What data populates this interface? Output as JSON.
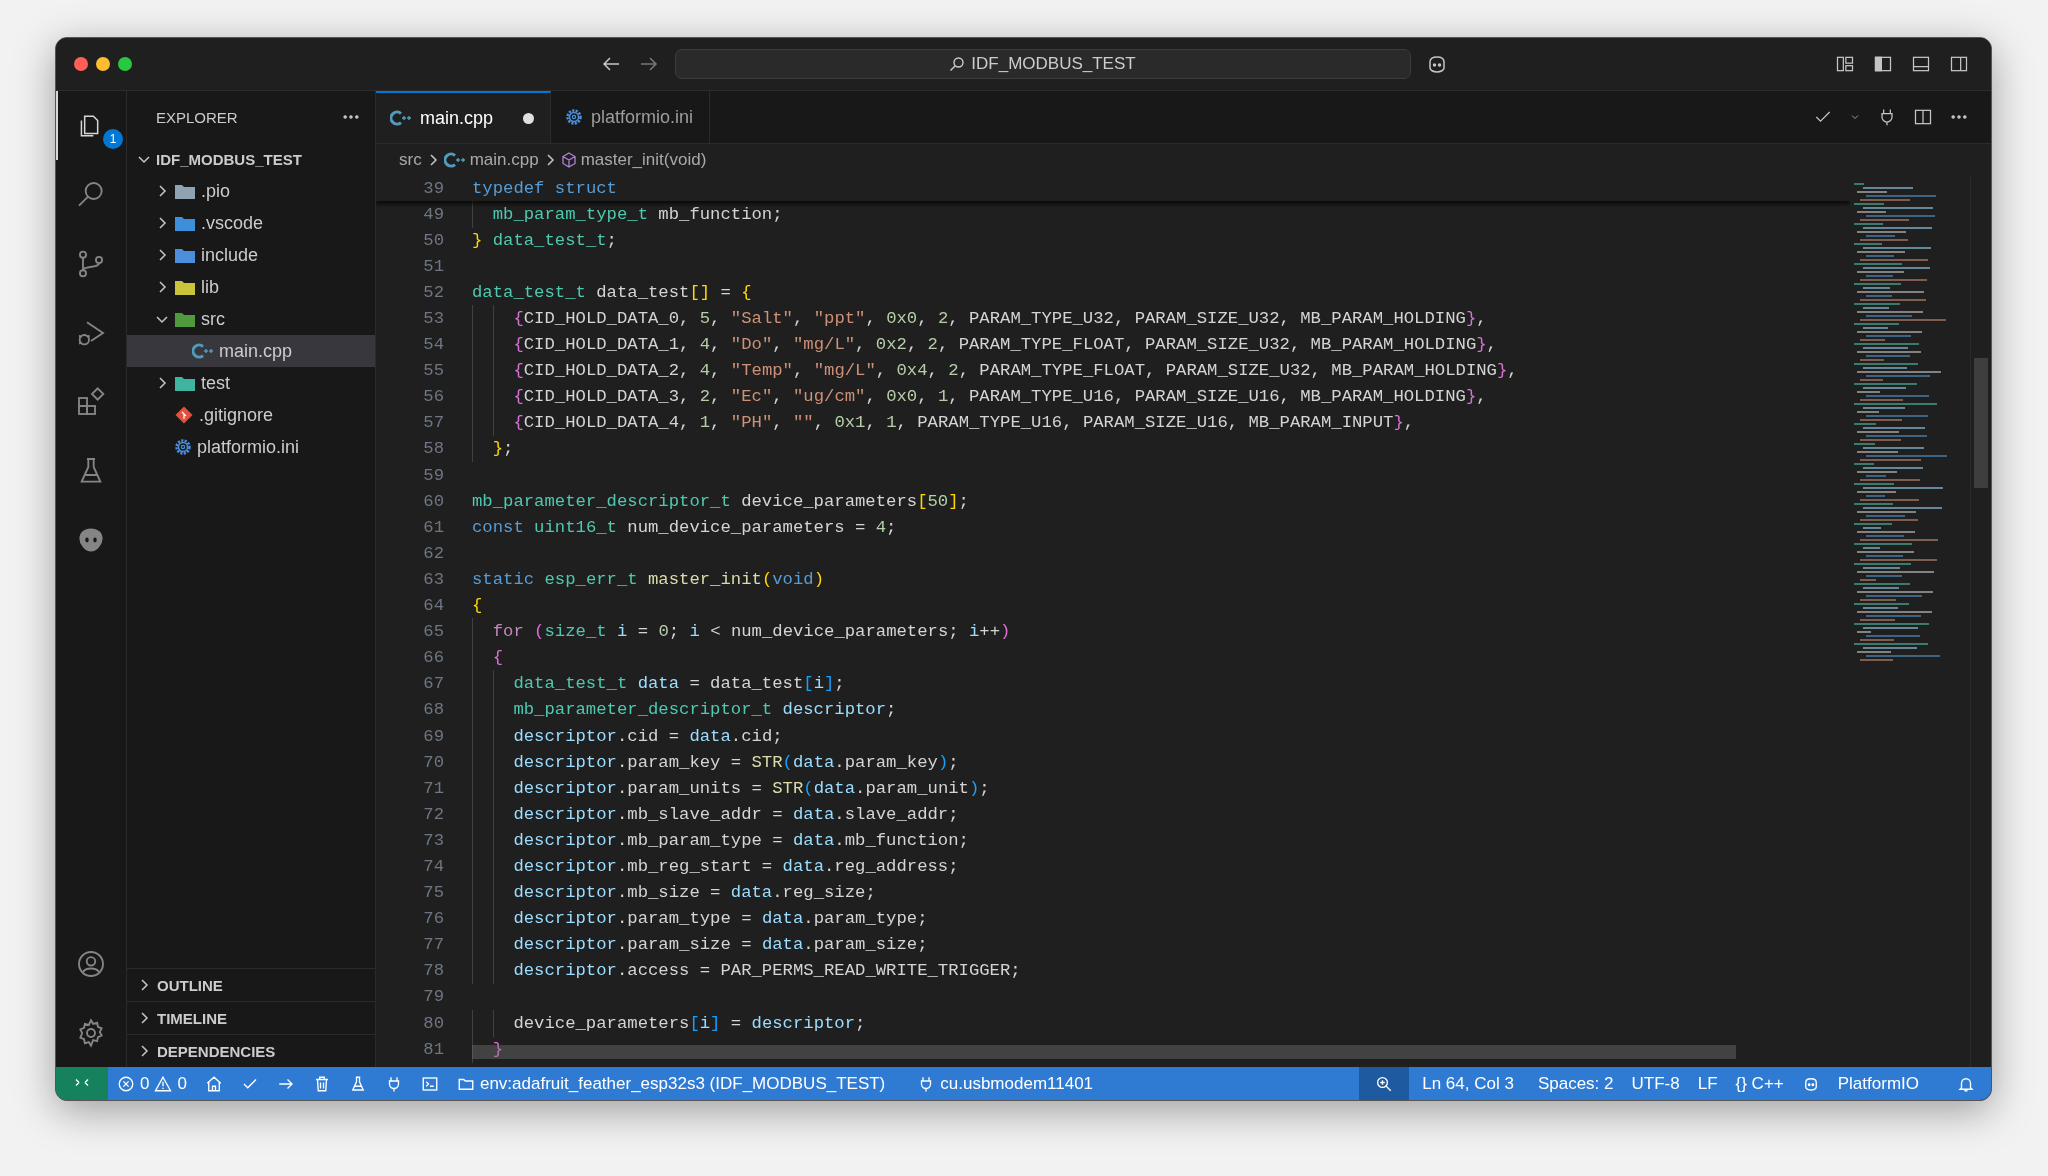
{
  "title_bar": {
    "search": "IDF_MODBUS_TEST"
  },
  "activity_bar": {
    "badge": "1"
  },
  "explorer": {
    "title": "EXPLORER",
    "root": {
      "label": "IDF_MODBUS_TEST",
      "expanded": true,
      "children": [
        {
          "label": ".pio",
          "kind": "folder",
          "expanded": false,
          "selected": false
        },
        {
          "label": ".vscode",
          "kind": "vscode-folder",
          "expanded": false,
          "selected": false
        },
        {
          "label": "include",
          "kind": "include-folder",
          "expanded": false,
          "selected": false
        },
        {
          "label": "lib",
          "kind": "lib-folder",
          "expanded": false,
          "selected": false
        },
        {
          "label": "src",
          "kind": "source-folder",
          "expanded": true,
          "selected": false,
          "children": [
            {
              "label": "main.cpp",
              "kind": "cpp-file",
              "selected": true
            }
          ]
        },
        {
          "label": "test",
          "kind": "test-folder",
          "expanded": false,
          "selected": false
        },
        {
          "label": ".gitignore",
          "kind": "git-file",
          "selected": false
        },
        {
          "label": "platformio.ini",
          "kind": "settings-file",
          "selected": false
        }
      ]
    },
    "sections": [
      {
        "label": "OUTLINE",
        "expanded": false
      },
      {
        "label": "TIMELINE",
        "expanded": false
      },
      {
        "label": "DEPENDENCIES",
        "expanded": false
      }
    ]
  },
  "tabs": [
    {
      "label": "main.cpp",
      "kind": "cpp",
      "selected": true,
      "modified": true
    },
    {
      "label": "platformio.ini",
      "kind": "settings",
      "selected": false,
      "modified": false
    }
  ],
  "breadcrumbs": [
    {
      "label": "src",
      "kind": "folder"
    },
    {
      "label": "main.cpp",
      "kind": "cpp"
    },
    {
      "label": "master_init(void)",
      "kind": "function"
    }
  ],
  "editor": {
    "sticky_line": {
      "number": "39",
      "tokens": [
        {
          "kind": "kw",
          "text": "typedef"
        },
        {
          "kind": "kw",
          "text": " struct"
        }
      ]
    },
    "lines": [
      {
        "number": "49",
        "tokens": [
          {
            "kind": "type",
            "text": "  mb_param_type_t"
          },
          {
            "kind": "plain",
            "text": " mb_function;"
          }
        ]
      },
      {
        "number": "50",
        "tokens": [
          {
            "kind": "b1",
            "text": "}"
          },
          {
            "kind": "type",
            "text": " data_test_t"
          },
          {
            "kind": "plain",
            "text": ";"
          }
        ]
      },
      {
        "number": "51"
      },
      {
        "number": "52",
        "tokens": [
          {
            "kind": "type",
            "text": "data_test_t"
          },
          {
            "kind": "plain",
            "text": " data_test"
          },
          {
            "kind": "b1",
            "text": "[]"
          },
          {
            "kind": "plain",
            "text": " = "
          },
          {
            "kind": "b1",
            "text": "{"
          }
        ]
      },
      {
        "number": "53",
        "tokens": [
          {
            "kind": "b2",
            "text": "    {"
          },
          {
            "kind": "plain",
            "text": "CID_HOLD_DATA_0, "
          },
          {
            "kind": "num",
            "text": "5"
          },
          {
            "kind": "plain",
            "text": ", "
          },
          {
            "kind": "str",
            "text": "\"Salt\""
          },
          {
            "kind": "plain",
            "text": ", "
          },
          {
            "kind": "str",
            "text": "\"ppt\""
          },
          {
            "kind": "plain",
            "text": ", "
          },
          {
            "kind": "num",
            "text": "0x0"
          },
          {
            "kind": "plain",
            "text": ", "
          },
          {
            "kind": "num",
            "text": "2"
          },
          {
            "kind": "plain",
            "text": ", PARAM_TYPE_U32, PARAM_SIZE_U32, MB_PARAM_HOLDING"
          },
          {
            "kind": "b2",
            "text": "}"
          },
          {
            "kind": "plain",
            "text": ","
          }
        ]
      },
      {
        "number": "54",
        "tokens": [
          {
            "kind": "b2",
            "text": "    {"
          },
          {
            "kind": "plain",
            "text": "CID_HOLD_DATA_1, "
          },
          {
            "kind": "num",
            "text": "4"
          },
          {
            "kind": "plain",
            "text": ", "
          },
          {
            "kind": "str",
            "text": "\"Do\""
          },
          {
            "kind": "plain",
            "text": ", "
          },
          {
            "kind": "str",
            "text": "\"mg/L\""
          },
          {
            "kind": "plain",
            "text": ", "
          },
          {
            "kind": "num",
            "text": "0x2"
          },
          {
            "kind": "plain",
            "text": ", "
          },
          {
            "kind": "num",
            "text": "2"
          },
          {
            "kind": "plain",
            "text": ", PARAM_TYPE_FLOAT, PARAM_SIZE_U32, MB_PARAM_HOLDING"
          },
          {
            "kind": "b2",
            "text": "}"
          },
          {
            "kind": "plain",
            "text": ","
          }
        ]
      },
      {
        "number": "55",
        "tokens": [
          {
            "kind": "b2",
            "text": "    {"
          },
          {
            "kind": "plain",
            "text": "CID_HOLD_DATA_2, "
          },
          {
            "kind": "num",
            "text": "4"
          },
          {
            "kind": "plain",
            "text": ", "
          },
          {
            "kind": "str",
            "text": "\"Temp\""
          },
          {
            "kind": "plain",
            "text": ", "
          },
          {
            "kind": "str",
            "text": "\"mg/L\""
          },
          {
            "kind": "plain",
            "text": ", "
          },
          {
            "kind": "num",
            "text": "0x4"
          },
          {
            "kind": "plain",
            "text": ", "
          },
          {
            "kind": "num",
            "text": "2"
          },
          {
            "kind": "plain",
            "text": ", PARAM_TYPE_FLOAT, PARAM_SIZE_U32, MB_PARAM_HOLDING"
          },
          {
            "kind": "b2",
            "text": "}"
          },
          {
            "kind": "plain",
            "text": ","
          }
        ]
      },
      {
        "number": "56",
        "tokens": [
          {
            "kind": "b2",
            "text": "    {"
          },
          {
            "kind": "plain",
            "text": "CID_HOLD_DATA_3, "
          },
          {
            "kind": "num",
            "text": "2"
          },
          {
            "kind": "plain",
            "text": ", "
          },
          {
            "kind": "str",
            "text": "\"Ec\""
          },
          {
            "kind": "plain",
            "text": ", "
          },
          {
            "kind": "str",
            "text": "\"ug/cm\""
          },
          {
            "kind": "plain",
            "text": ", "
          },
          {
            "kind": "num",
            "text": "0x0"
          },
          {
            "kind": "plain",
            "text": ", "
          },
          {
            "kind": "num",
            "text": "1"
          },
          {
            "kind": "plain",
            "text": ", PARAM_TYPE_U16, PARAM_SIZE_U16, MB_PARAM_HOLDING"
          },
          {
            "kind": "b2",
            "text": "}"
          },
          {
            "kind": "plain",
            "text": ","
          }
        ]
      },
      {
        "number": "57",
        "tokens": [
          {
            "kind": "b2",
            "text": "    {"
          },
          {
            "kind": "plain",
            "text": "CID_HOLD_DATA_4, "
          },
          {
            "kind": "num",
            "text": "1"
          },
          {
            "kind": "plain",
            "text": ", "
          },
          {
            "kind": "str",
            "text": "\"PH\""
          },
          {
            "kind": "plain",
            "text": ", "
          },
          {
            "kind": "str",
            "text": "\"\""
          },
          {
            "kind": "plain",
            "text": ", "
          },
          {
            "kind": "num",
            "text": "0x1"
          },
          {
            "kind": "plain",
            "text": ", "
          },
          {
            "kind": "num",
            "text": "1"
          },
          {
            "kind": "plain",
            "text": ", PARAM_TYPE_U16, PARAM_SIZE_U16, MB_PARAM_INPUT"
          },
          {
            "kind": "b2",
            "text": "}"
          },
          {
            "kind": "plain",
            "text": ","
          }
        ]
      },
      {
        "number": "58",
        "tokens": [
          {
            "kind": "b1",
            "text": "  }"
          },
          {
            "kind": "plain",
            "text": ";"
          }
        ]
      },
      {
        "number": "59"
      },
      {
        "number": "60",
        "tokens": [
          {
            "kind": "type",
            "text": "mb_parameter_descriptor_t"
          },
          {
            "kind": "plain",
            "text": " device_parameters"
          },
          {
            "kind": "b1",
            "text": "["
          },
          {
            "kind": "num",
            "text": "50"
          },
          {
            "kind": "b1",
            "text": "]"
          },
          {
            "kind": "plain",
            "text": ";"
          }
        ]
      },
      {
        "number": "61",
        "tokens": [
          {
            "kind": "kw",
            "text": "const"
          },
          {
            "kind": "type",
            "text": " uint16_t"
          },
          {
            "kind": "plain",
            "text": " num_device_parameters = "
          },
          {
            "kind": "num",
            "text": "4"
          },
          {
            "kind": "plain",
            "text": ";"
          }
        ]
      },
      {
        "number": "62"
      },
      {
        "number": "63",
        "tokens": [
          {
            "kind": "kw",
            "text": "static"
          },
          {
            "kind": "type",
            "text": " esp_err_t"
          },
          {
            "kind": "func",
            "text": " master_init"
          },
          {
            "kind": "b1",
            "text": "("
          },
          {
            "kind": "kw",
            "text": "void"
          },
          {
            "kind": "b1",
            "text": ")"
          }
        ]
      },
      {
        "number": "64",
        "tokens": [
          {
            "kind": "b1",
            "text": "{"
          }
        ]
      },
      {
        "number": "65",
        "tokens": [
          {
            "kind": "ctrl",
            "text": "  for"
          },
          {
            "kind": "b2",
            "text": " ("
          },
          {
            "kind": "type",
            "text": "size_t"
          },
          {
            "kind": "var",
            "text": " i"
          },
          {
            "kind": "plain",
            "text": " = "
          },
          {
            "kind": "num",
            "text": "0"
          },
          {
            "kind": "plain",
            "text": "; "
          },
          {
            "kind": "var",
            "text": "i"
          },
          {
            "kind": "plain",
            "text": " < num_device_parameters; "
          },
          {
            "kind": "var",
            "text": "i"
          },
          {
            "kind": "plain",
            "text": "++"
          },
          {
            "kind": "b2",
            "text": ")"
          }
        ]
      },
      {
        "number": "66",
        "tokens": [
          {
            "kind": "b2",
            "text": "  {"
          }
        ]
      },
      {
        "number": "67",
        "tokens": [
          {
            "kind": "type",
            "text": "    data_test_t"
          },
          {
            "kind": "var",
            "text": " data"
          },
          {
            "kind": "plain",
            "text": " = data_test"
          },
          {
            "kind": "b3",
            "text": "["
          },
          {
            "kind": "var",
            "text": "i"
          },
          {
            "kind": "b3",
            "text": "]"
          },
          {
            "kind": "plain",
            "text": ";"
          }
        ]
      },
      {
        "number": "68",
        "tokens": [
          {
            "kind": "type",
            "text": "    mb_parameter_descriptor_t"
          },
          {
            "kind": "var",
            "text": " descriptor"
          },
          {
            "kind": "plain",
            "text": ";"
          }
        ]
      },
      {
        "number": "69",
        "tokens": [
          {
            "kind": "var",
            "text": "    descriptor"
          },
          {
            "kind": "plain",
            "text": ".cid = "
          },
          {
            "kind": "var",
            "text": "data"
          },
          {
            "kind": "plain",
            "text": ".cid;"
          }
        ]
      },
      {
        "number": "70",
        "tokens": [
          {
            "kind": "var",
            "text": "    descriptor"
          },
          {
            "kind": "plain",
            "text": ".param_key = "
          },
          {
            "kind": "func",
            "text": "STR"
          },
          {
            "kind": "b3",
            "text": "("
          },
          {
            "kind": "var",
            "text": "data"
          },
          {
            "kind": "plain",
            "text": ".param_key"
          },
          {
            "kind": "b3",
            "text": ")"
          },
          {
            "kind": "plain",
            "text": ";"
          }
        ]
      },
      {
        "number": "71",
        "tokens": [
          {
            "kind": "var",
            "text": "    descriptor"
          },
          {
            "kind": "plain",
            "text": ".param_units = "
          },
          {
            "kind": "func",
            "text": "STR"
          },
          {
            "kind": "b3",
            "text": "("
          },
          {
            "kind": "var",
            "text": "data"
          },
          {
            "kind": "plain",
            "text": ".param_unit"
          },
          {
            "kind": "b3",
            "text": ")"
          },
          {
            "kind": "plain",
            "text": ";"
          }
        ]
      },
      {
        "number": "72",
        "tokens": [
          {
            "kind": "var",
            "text": "    descriptor"
          },
          {
            "kind": "plain",
            "text": ".mb_slave_addr = "
          },
          {
            "kind": "var",
            "text": "data"
          },
          {
            "kind": "plain",
            "text": ".slave_addr;"
          }
        ]
      },
      {
        "number": "73",
        "tokens": [
          {
            "kind": "var",
            "text": "    descriptor"
          },
          {
            "kind": "plain",
            "text": ".mb_param_type = "
          },
          {
            "kind": "var",
            "text": "data"
          },
          {
            "kind": "plain",
            "text": ".mb_function;"
          }
        ]
      },
      {
        "number": "74",
        "tokens": [
          {
            "kind": "var",
            "text": "    descriptor"
          },
          {
            "kind": "plain",
            "text": ".mb_reg_start = "
          },
          {
            "kind": "var",
            "text": "data"
          },
          {
            "kind": "plain",
            "text": ".reg_address;"
          }
        ]
      },
      {
        "number": "75",
        "tokens": [
          {
            "kind": "var",
            "text": "    descriptor"
          },
          {
            "kind": "plain",
            "text": ".mb_size = "
          },
          {
            "kind": "var",
            "text": "data"
          },
          {
            "kind": "plain",
            "text": ".reg_size;"
          }
        ]
      },
      {
        "number": "76",
        "tokens": [
          {
            "kind": "var",
            "text": "    descriptor"
          },
          {
            "kind": "plain",
            "text": ".param_type = "
          },
          {
            "kind": "var",
            "text": "data"
          },
          {
            "kind": "plain",
            "text": ".param_type;"
          }
        ]
      },
      {
        "number": "77",
        "tokens": [
          {
            "kind": "var",
            "text": "    descriptor"
          },
          {
            "kind": "plain",
            "text": ".param_size = "
          },
          {
            "kind": "var",
            "text": "data"
          },
          {
            "kind": "plain",
            "text": ".param_size;"
          }
        ]
      },
      {
        "number": "78",
        "tokens": [
          {
            "kind": "var",
            "text": "    descriptor"
          },
          {
            "kind": "plain",
            "text": ".access = PAR_PERMS_READ_WRITE_TRIGGER;"
          }
        ]
      },
      {
        "number": "79"
      },
      {
        "number": "80",
        "tokens": [
          {
            "kind": "plain",
            "text": "    device_parameters"
          },
          {
            "kind": "b3",
            "text": "["
          },
          {
            "kind": "var",
            "text": "i"
          },
          {
            "kind": "b3",
            "text": "]"
          },
          {
            "kind": "plain",
            "text": " = "
          },
          {
            "kind": "var",
            "text": "descriptor"
          },
          {
            "kind": "plain",
            "text": ";"
          }
        ]
      },
      {
        "number": "81",
        "tokens": [
          {
            "kind": "b2",
            "text": "  }"
          }
        ]
      }
    ]
  },
  "status_bar": {
    "errors": "0",
    "warnings": "0",
    "environment": "env:adafruit_feather_esp32s3 (IDF_MODBUS_TEST)",
    "port": "cu.usbmodem11401",
    "position": "Ln 64, Col 3",
    "indentation": "Spaces: 2",
    "encoding": "UTF-8",
    "line_ending": "LF",
    "language_icon": "{}",
    "language": "C++",
    "platform": "PlatformIO"
  }
}
